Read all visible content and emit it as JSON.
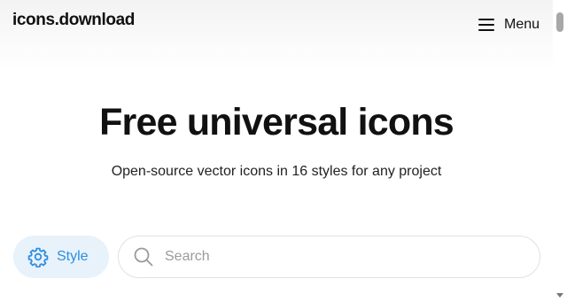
{
  "header": {
    "logo": "icons.download",
    "menu_label": "Menu",
    "menu_icon": "hamburger-icon"
  },
  "hero": {
    "title": "Free universal icons",
    "subtitle": "Open-source vector icons in 16 styles for any project"
  },
  "controls": {
    "style_label": "Style",
    "style_icon": "gear-icon",
    "search_placeholder": "Search",
    "search_value": "",
    "search_icon": "search-icon"
  },
  "colors": {
    "accent": "#2f8ede",
    "style_button_bg": "#e8f2fb",
    "text": "#111111",
    "placeholder": "#9b9b9b"
  }
}
